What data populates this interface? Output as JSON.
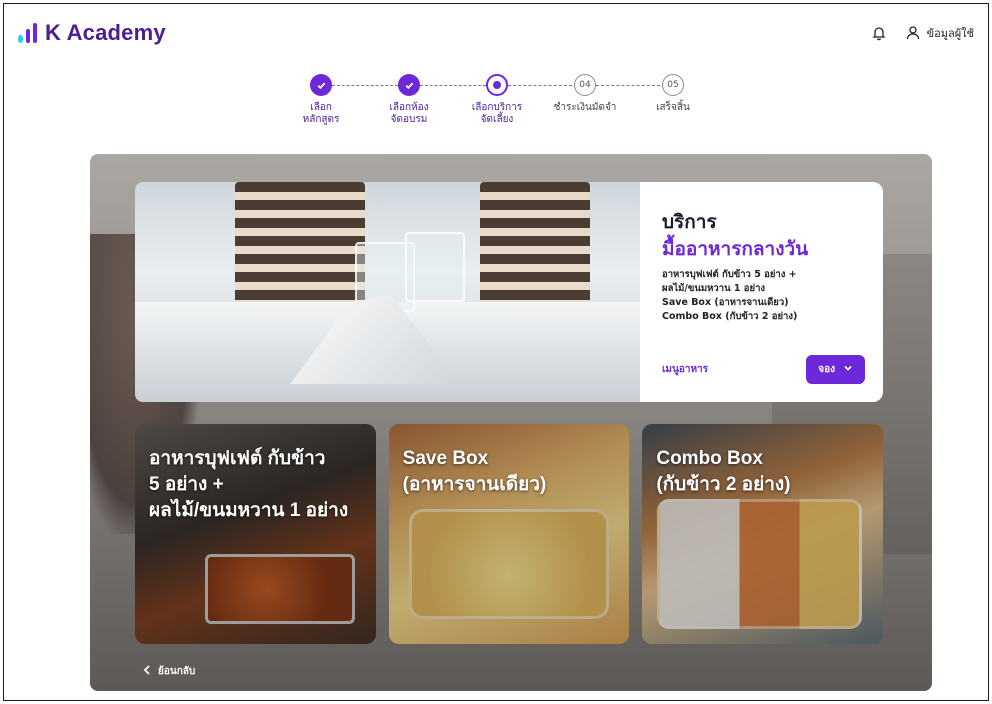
{
  "app": {
    "brand": "K Academy",
    "user_label": "ข้อมูลผู้ใช้"
  },
  "stepper": {
    "steps": [
      {
        "label": "เลือก\nหลักสูตร",
        "state": "done",
        "number": ""
      },
      {
        "label": "เลือกห้อง\nจัดอบรม",
        "state": "done",
        "number": ""
      },
      {
        "label": "เลือกบริการ\nจัดเลี้ยง",
        "state": "current",
        "number": ""
      },
      {
        "label": "ชำระเงินมัดจำ",
        "state": "todo",
        "number": "04"
      },
      {
        "label": "เสร็จสิ้น",
        "state": "todo",
        "number": "05"
      }
    ]
  },
  "service_card": {
    "title": "บริการ",
    "subtitle": "มื้ออาหารกลางวัน",
    "desc_lines": [
      "อาหารบุฟเฟต์ กับข้าว 5 อย่าง +",
      "ผลไม้/ขนมหวาน 1 อย่าง",
      "Save Box (อาหารจานเดียว)",
      "Combo Box (กับข้าว 2 อย่าง)"
    ],
    "menu_link": "เมนูอาหาร",
    "book_button": "จอง"
  },
  "tiles": [
    {
      "text": "อาหารบุฟเฟต์ กับข้าว\n5 อย่าง +\nผลไม้/ขนมหวาน 1 อย่าง"
    },
    {
      "text": "Save Box\n(อาหารจานเดียว)"
    },
    {
      "text": "Combo Box\n(กับข้าว 2 อย่าง)"
    }
  ],
  "back_label": "ย้อนกลับ",
  "colors": {
    "accent": "#6d28d9",
    "brand_dark": "#4c1d95",
    "logo_dot": "#22d3ee"
  },
  "icons": {
    "bell": "bell-icon",
    "user": "user-icon",
    "check": "check-icon",
    "chevron_down": "chevron-down-icon",
    "chevron_left": "chevron-left-icon"
  }
}
